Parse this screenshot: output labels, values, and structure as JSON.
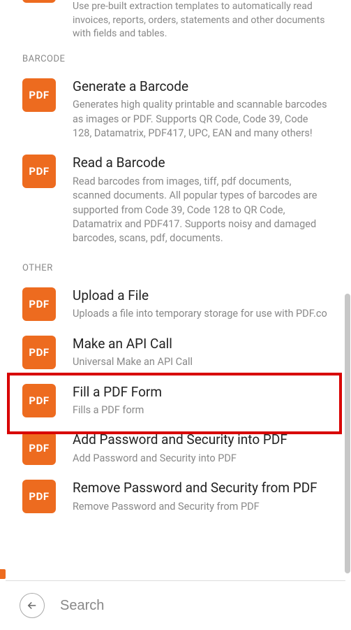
{
  "partial_item": {
    "desc_partial": "Use pre-built extraction templates to automatically read invoices, reports, orders, statements and other documents with fields and tables."
  },
  "icon_label": "PDF",
  "sections": [
    {
      "label": "BARCODE",
      "items": [
        {
          "title": "Generate a Barcode",
          "desc": "Generates high quality printable and scannable barcodes as images or PDF. Supports QR Code, Code 39, Code 128, Datamatrix, PDF417, UPC, EAN and many others!"
        },
        {
          "title": "Read a Barcode",
          "desc": "Read barcodes from images, tiff, pdf documents, scanned documents. All popular types of barcodes are supported from Code 39, Code 128 to QR Code, Datamatrix and PDF417. Supports noisy and damaged barcodes, scans, pdf, documents."
        }
      ]
    },
    {
      "label": "OTHER",
      "items": [
        {
          "title": "Upload a File",
          "desc": "Uploads a file into temporary storage for use with PDF.co"
        },
        {
          "title": "Make an API Call",
          "desc": "Universal Make an API Call"
        },
        {
          "title": "Fill a PDF Form",
          "desc": "Fills a PDF form"
        },
        {
          "title": "Add Password and Security into PDF",
          "desc": "Add Password and Security into PDF"
        },
        {
          "title": "Remove Password and Security from PDF",
          "desc": "Remove Password and Security from PDF"
        }
      ]
    }
  ],
  "search": {
    "placeholder": "Search",
    "value": ""
  }
}
